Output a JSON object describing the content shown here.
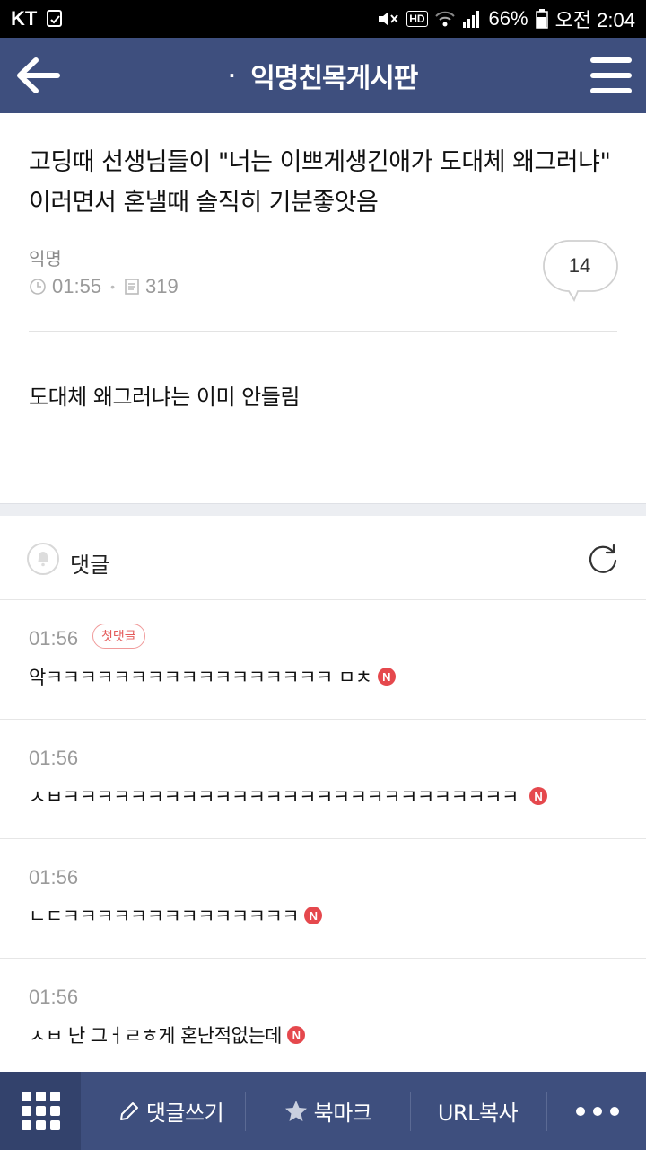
{
  "status_bar": {
    "carrier": "KT",
    "battery": "66%",
    "time": "오전 2:04",
    "icons": [
      "notification-icon",
      "mute-icon",
      "hd-icon",
      "wifi-icon",
      "signal-icon",
      "battery-icon"
    ],
    "hd_label": "HD"
  },
  "header": {
    "title": "익명친목게시판",
    "dot": "·"
  },
  "post": {
    "title": "고딩때 선생님들이 \"너는 이쁘게생긴애가 도대체 왜그러냐\" 이러면서 혼낼때 솔직히 기분좋앗음",
    "author": "익명",
    "time": "01:55",
    "views": "319",
    "comment_count": "14",
    "body": "도대체 왜그러냐는 이미 안들림"
  },
  "comments_section": {
    "label": "댓글",
    "items": [
      {
        "time": "01:56",
        "badge": "첫댓글",
        "text": "악ㅋㅋㅋㅋㅋㅋㅋㅋㅋㅋㅋㅋㅋㅋㅋㅋㅋ ㅁㅊ",
        "new": "N"
      },
      {
        "time": "01:56",
        "text": "ㅅㅂㅋㅋㅋㅋㅋㅋㅋㅋㅋㅋㅋㅋㅋㅋㅋㅋㅋㅋㅋㅋㅋㅋㅋㅋㅋㅋㅋ",
        "new": "N"
      },
      {
        "time": "01:56",
        "text": "ㄴㄷㅋㅋㅋㅋㅋㅋㅋㅋㅋㅋㅋㅋㅋㅋ",
        "new": "N"
      },
      {
        "time": "01:56",
        "text": "ㅅㅂ 난 그ㅓㄹㅎ게 혼난적없는데",
        "new": "N"
      }
    ]
  },
  "bottom_bar": {
    "write_comment": "댓글쓰기",
    "bookmark": "북마크",
    "copy_url": "URL복사"
  },
  "colors": {
    "header_bg": "#3e4f7e",
    "bottom_bar_bg": "#3e4f7e",
    "grid_button_bg": "#33426c",
    "new_badge": "#e5484d",
    "first_badge": "#e45a5a"
  }
}
